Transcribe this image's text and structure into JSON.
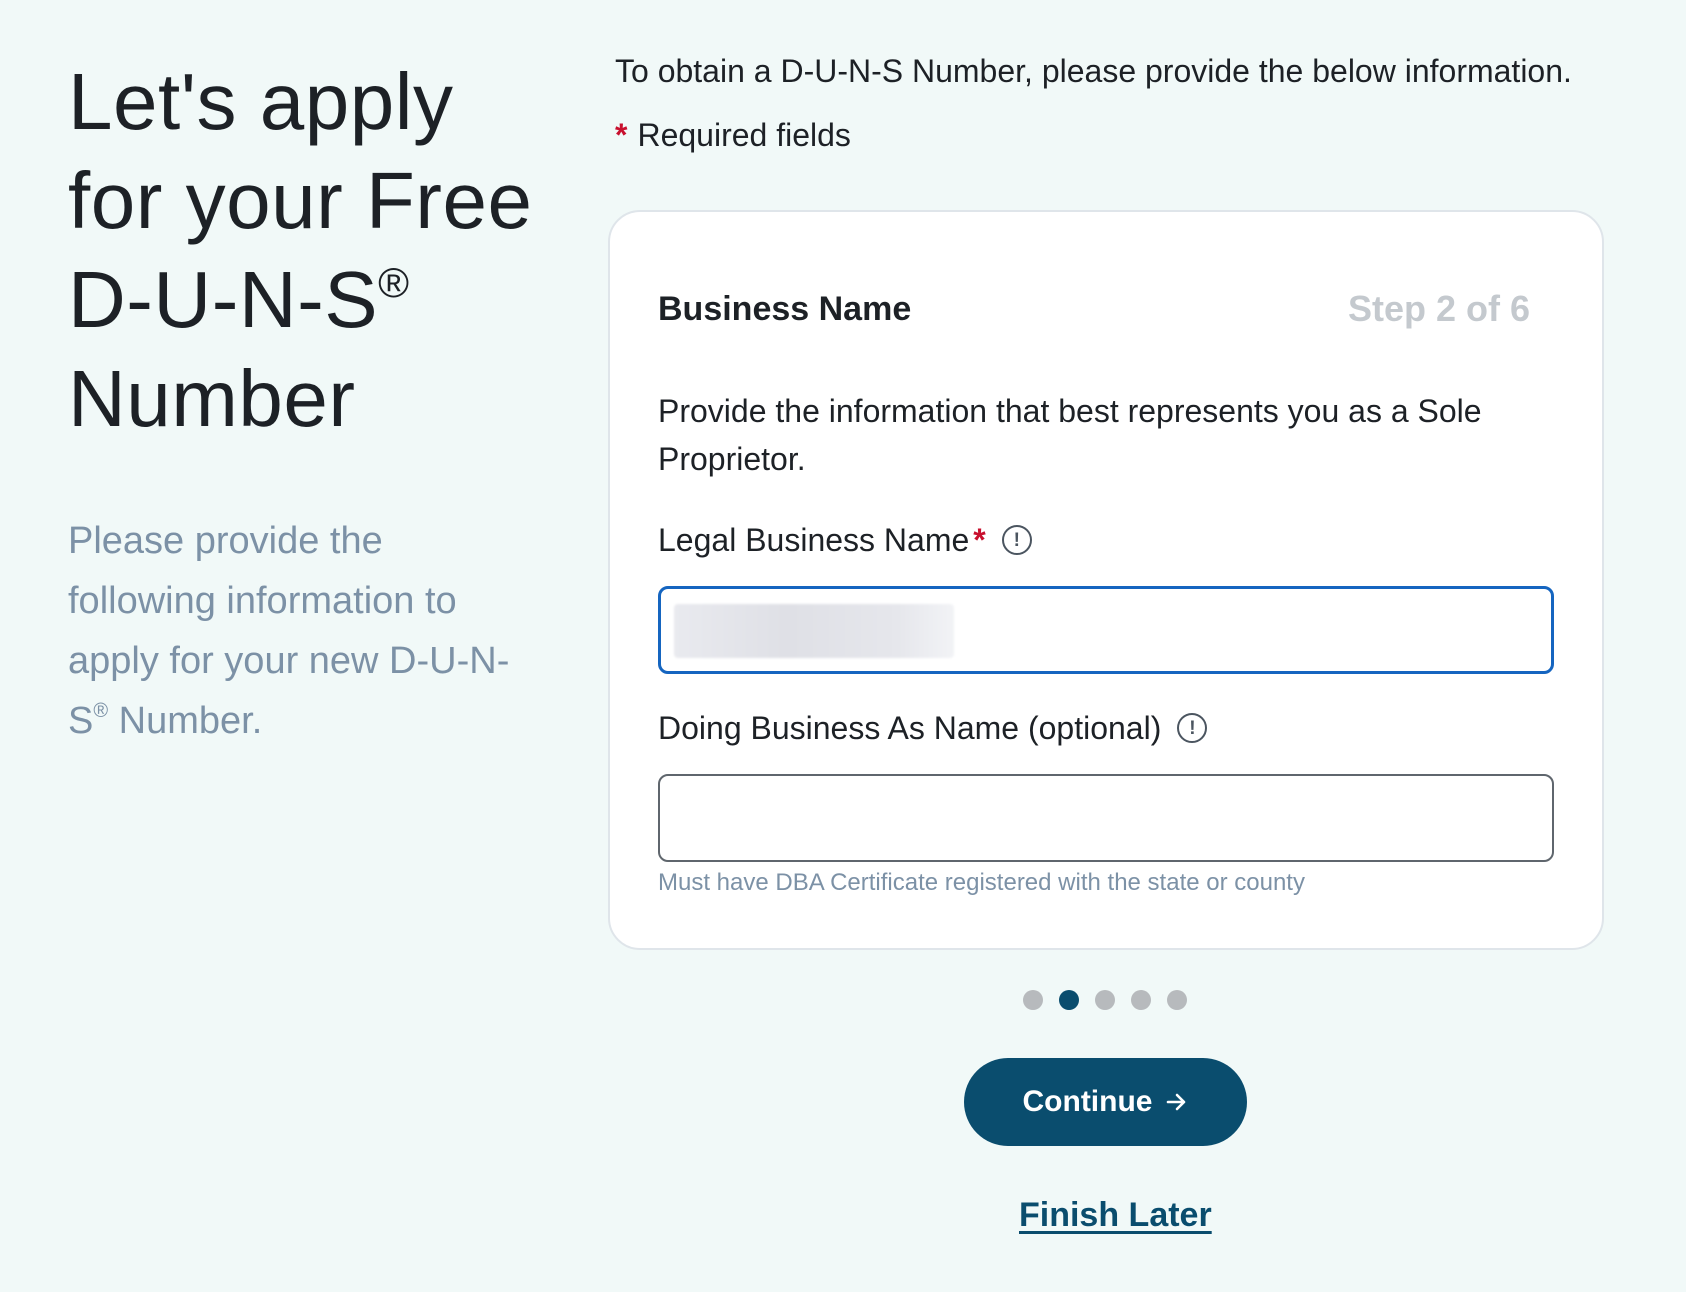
{
  "hero": {
    "title_line1": "Let's apply",
    "title_line2": "for your Free",
    "title_line3": "D-U-N-S",
    "title_registered": "®",
    "title_line4": "Number",
    "subtitle_part1": "Please provide the following information to apply for your new D-U-N-S",
    "subtitle_registered": "®",
    "subtitle_part2": " Number."
  },
  "intro": {
    "text": "To obtain a D-U-N-S Number, please provide the below information.",
    "required_marker": "*",
    "required_text": "Required fields"
  },
  "card": {
    "title": "Business Name",
    "step": "Step 2 of 6",
    "description": "Provide the information that best represents you as a Sole Proprietor.",
    "legal_name": {
      "label": "Legal Business Name",
      "required_marker": "*",
      "info_icon": "info-icon",
      "value": ""
    },
    "dba_name": {
      "label": "Doing Business As Name (optional)",
      "info_icon": "info-icon",
      "value": "",
      "helper": "Must have DBA Certificate registered with the state or county"
    }
  },
  "pagination": {
    "total": 5,
    "active_index": 1
  },
  "actions": {
    "continue_label": "Continue",
    "continue_icon": "arrow-right-icon",
    "finish_later_label": "Finish Later"
  },
  "colors": {
    "background": "#f1f9f8",
    "primary": "#0a4d6e",
    "required": "#c8102e",
    "focus_border": "#1565c0",
    "muted_text": "#7c91a6",
    "step_text": "#c4c9ce"
  }
}
